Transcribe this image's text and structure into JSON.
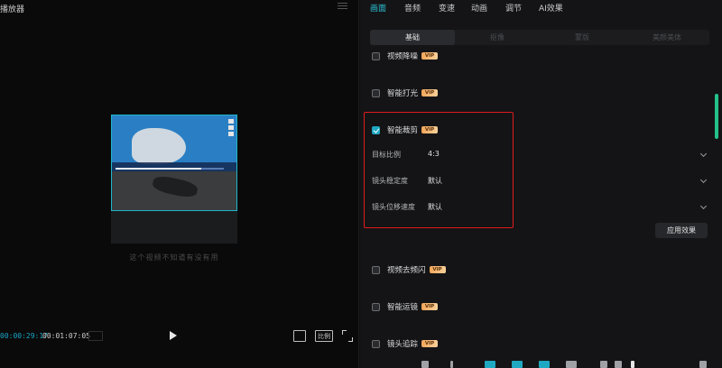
{
  "player": {
    "title": "播放器",
    "subtitle": "这个视频不知道有没有用",
    "time_current": "00:00:29:17",
    "time_total": "00:01:07:05",
    "ratio_label": "比例"
  },
  "panel": {
    "top_tabs": [
      {
        "label": "画面",
        "active": true
      },
      {
        "label": "音频"
      },
      {
        "label": "变速"
      },
      {
        "label": "动画"
      },
      {
        "label": "调节"
      },
      {
        "label": "AI效果"
      }
    ],
    "sub_tabs": [
      {
        "label": "基础",
        "active": true
      },
      {
        "label": "抠像"
      },
      {
        "label": "蒙版"
      },
      {
        "label": "美颜美体"
      }
    ],
    "vip_badge": "VIP",
    "items": {
      "video_denoise": "视频降噪",
      "smart_light": "智能打光",
      "smart_crop": "智能裁剪",
      "video_deflicker": "视频去频闪",
      "smart_motion": "智能运镜",
      "lens_track": "镜头追踪"
    },
    "crop_settings": {
      "target_ratio_label": "目标比例",
      "target_ratio_value": "4:3",
      "stability_label": "镜头稳定度",
      "stability_value": "默认",
      "speed_label": "镜头位移速度",
      "speed_value": "默认"
    },
    "apply_label": "应用效果"
  },
  "colors": {
    "accent": "#2bc3d7",
    "highlight": "#e01b1b",
    "vip": "#f2a55a"
  }
}
